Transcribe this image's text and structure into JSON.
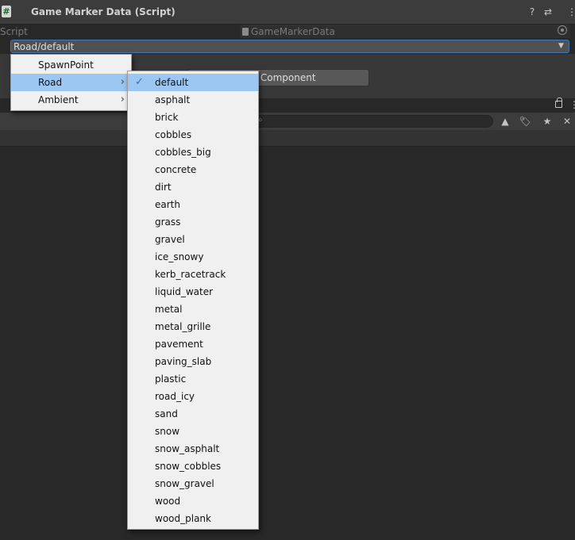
{
  "component": {
    "title": "Game Marker Data (Script)",
    "script_icon_glyph": "#",
    "script_label": "Script",
    "script_value": "GameMarkerData",
    "dropdown_value": "Road/default",
    "add_component_label": "/ Component"
  },
  "icons": {
    "help": "?",
    "settings": "⇄",
    "more": "⋮",
    "search": "🔍",
    "tool1": "▲",
    "tag": "🏷",
    "star": "★",
    "hidden": "✕"
  },
  "menu_categories": {
    "items": [
      {
        "label": "SpawnPoint",
        "has_submenu": false
      },
      {
        "label": "Road",
        "has_submenu": true
      },
      {
        "label": "Ambient",
        "has_submenu": true
      }
    ],
    "highlighted_index": 1
  },
  "menu_road": {
    "checked_index": 0,
    "highlighted_index": 0,
    "items": [
      "default",
      "asphalt",
      "brick",
      "cobbles",
      "cobbles_big",
      "concrete",
      "dirt",
      "earth",
      "grass",
      "gravel",
      "ice_snowy",
      "kerb_racetrack",
      "liquid_water",
      "metal",
      "metal_grille",
      "pavement",
      "paving_slab",
      "plastic",
      "road_icy",
      "sand",
      "snow",
      "snow_asphalt",
      "snow_cobbles",
      "snow_gravel",
      "wood",
      "wood_plank"
    ]
  },
  "colors": {
    "highlight": "#9bc7f2",
    "check": "#2f6fb5",
    "focus_border": "#3a79bb"
  }
}
